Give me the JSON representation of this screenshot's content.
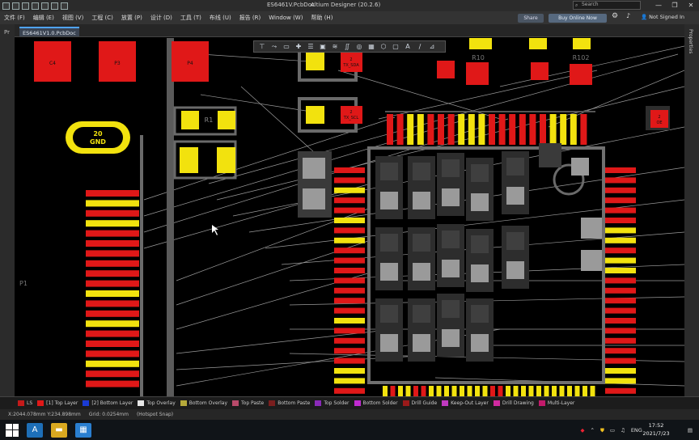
{
  "window": {
    "document_title": "ES6461V.PcbDoc",
    "app_title": "Altium Designer (20.2.6)",
    "search_placeholder": "Search",
    "minimize": "—",
    "maximize": "❐",
    "close": "✕"
  },
  "menu": {
    "items": [
      "文件 (F)",
      "编辑 (E)",
      "视图 (V)",
      "工程 (C)",
      "放置 (P)",
      "设计 (D)",
      "工具 (T)",
      "布线 (U)",
      "报告 (R)",
      "Window (W)",
      "帮助 (H)"
    ],
    "share_label": "Share",
    "buy_label": "Buy Online Now",
    "sign_in_label": "Not Signed In"
  },
  "tabs": {
    "side_label": "Pr",
    "doc_tab": "ES6461V1.0.PcbDoc",
    "right_panel": "Properties"
  },
  "pcb": {
    "pads_red_top": [
      "C4",
      "P3",
      "P4"
    ],
    "gnd_pad_number": "20",
    "gnd_pad_net": "GND",
    "designators": [
      "R1",
      "P1",
      "R10",
      "R102"
    ],
    "pad_labels": [
      "TX_SDA",
      "TX_SCL",
      "OE"
    ],
    "pad_numbers": [
      "2",
      "2",
      "2"
    ]
  },
  "layers": [
    {
      "name": "LS",
      "color": "#c41a1a"
    },
    {
      "name": "[1] Top Layer",
      "color": "#e01818"
    },
    {
      "name": "[2] Bottom Layer",
      "color": "#1a3bd4"
    },
    {
      "name": "Top Overlay",
      "color": "#e6e6e6"
    },
    {
      "name": "Bottom Overlay",
      "color": "#b5a93a"
    },
    {
      "name": "Top Paste",
      "color": "#b84a6a"
    },
    {
      "name": "Bottom Paste",
      "color": "#7a1e1e"
    },
    {
      "name": "Top Solder",
      "color": "#8a2ab8"
    },
    {
      "name": "Bottom Solder",
      "color": "#c02ad0"
    },
    {
      "name": "Drill Guide",
      "color": "#9a1a1a"
    },
    {
      "name": "Keep-Out Layer",
      "color": "#c03ac0"
    },
    {
      "name": "Drill Drawing",
      "color": "#d02aa0"
    },
    {
      "name": "Multi-Layer",
      "color": "#c21a6a"
    }
  ],
  "status": {
    "coords": "X:2044.078mm Y:234.898mm",
    "grid": "Grid: 0.0254mm",
    "hotspot": "(Hotspot Snap)"
  },
  "taskbar": {
    "lang": "ENG",
    "time": "17:52",
    "date": "2021/7/23"
  },
  "colors": {
    "pad_red": "#e01818",
    "pad_yellow": "#f2e20e",
    "grey_pad": "#9a9a9a",
    "accent": "#4fa3ff"
  }
}
